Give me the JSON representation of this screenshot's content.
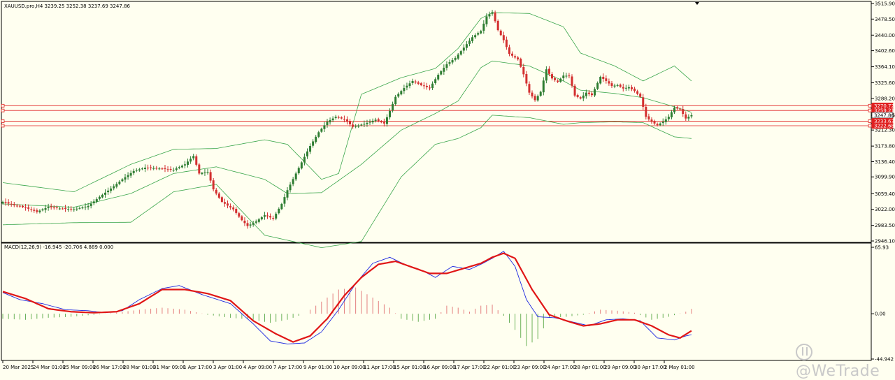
{
  "header": {
    "symbol_line": "XAUUSD.pro,H4  3239.25 3252.38 3237.69 3247.86"
  },
  "indicator": {
    "label": "MACD(12,26,9) -16.945 -20.706 4.889 0.000"
  },
  "watermark": {
    "text": "@WeTrade"
  },
  "colors": {
    "background": "#fffff0",
    "bull_candle": "#2e7d32",
    "bear_candle": "#d32f2f",
    "bollinger": "#3aa64a",
    "macd_line": "#1f2ae0",
    "signal_line": "#e01616",
    "hist_positive": "#e07070",
    "hist_negative": "#5aa846",
    "level_line": "#e02020",
    "grid_border": "#000000"
  },
  "chart_data": [
    {
      "type": "candlestick",
      "title": "XAUUSD.pro,H4",
      "y_ticks": [
        "3515.90",
        "3478.50",
        "3440.00",
        "3402.60",
        "3364.10",
        "3325.60",
        "3288.20",
        "3247.86",
        "3212.30",
        "3173.80",
        "3136.40",
        "3099.90",
        "3059.40",
        "3022.00",
        "2983.50",
        "2946.10"
      ],
      "ylim": [
        2946.1,
        3515.9
      ],
      "price_labels": [
        {
          "text": "3270.72",
          "value": 3270.72
        },
        {
          "text": "3259.21",
          "value": 3259.21
        },
        {
          "text": "3247.86",
          "value": 3247.86
        },
        {
          "text": "3233.63",
          "value": 3233.63
        },
        {
          "text": "3222.68",
          "value": 3222.68
        }
      ],
      "level_lines": [
        3270.72,
        3259.21,
        3233.63,
        3222.68
      ],
      "x_labels": [
        "20 Mar 2025",
        "24 Mar 01:00",
        "25 Mar 09:00",
        "26 Mar 17:00",
        "28 Mar 01:00",
        "31 Mar 09:00",
        "1 Apr 17:00",
        "3 Apr 01:00",
        "4 Apr 09:00",
        "7 Apr 17:00",
        "9 Apr 01:00",
        "10 Apr 09:00",
        "11 Apr 17:00",
        "15 Apr 01:00",
        "16 Apr 09:00",
        "17 Apr 17:00",
        "22 Apr 01:00",
        "23 Apr 09:00",
        "24 Apr 17:00",
        "28 Apr 01:00",
        "29 Apr 09:00",
        "30 Apr 17:00",
        "2 May 01:00"
      ],
      "close_anchors": [
        [
          0,
          3040
        ],
        [
          4,
          3032
        ],
        [
          8,
          3026
        ],
        [
          12,
          3016
        ],
        [
          16,
          3028
        ],
        [
          20,
          3024
        ],
        [
          25,
          3022
        ],
        [
          30,
          3030
        ],
        [
          34,
          3052
        ],
        [
          38,
          3072
        ],
        [
          42,
          3094
        ],
        [
          46,
          3114
        ],
        [
          50,
          3122
        ],
        [
          55,
          3120
        ],
        [
          60,
          3117
        ],
        [
          64,
          3130
        ],
        [
          67,
          3150
        ],
        [
          69,
          3108
        ],
        [
          72,
          3112
        ],
        [
          74,
          3070
        ],
        [
          77,
          3040
        ],
        [
          81,
          3022
        ],
        [
          84,
          2996
        ],
        [
          86,
          2982
        ],
        [
          89,
          2993
        ],
        [
          92,
          3008
        ],
        [
          95,
          3000
        ],
        [
          98,
          3035
        ],
        [
          100,
          3068
        ],
        [
          103,
          3108
        ],
        [
          106,
          3148
        ],
        [
          108,
          3174
        ],
        [
          111,
          3207
        ],
        [
          114,
          3232
        ],
        [
          117,
          3244
        ],
        [
          120,
          3238
        ],
        [
          123,
          3220
        ],
        [
          127,
          3227
        ],
        [
          131,
          3237
        ],
        [
          134,
          3228
        ],
        [
          136,
          3258
        ],
        [
          138,
          3292
        ],
        [
          141,
          3313
        ],
        [
          144,
          3330
        ],
        [
          147,
          3320
        ],
        [
          150,
          3313
        ],
        [
          153,
          3345
        ],
        [
          156,
          3370
        ],
        [
          159,
          3385
        ],
        [
          162,
          3410
        ],
        [
          165,
          3435
        ],
        [
          168,
          3450
        ],
        [
          170,
          3485
        ],
        [
          172,
          3495
        ],
        [
          174,
          3452
        ],
        [
          176,
          3428
        ],
        [
          178,
          3395
        ],
        [
          181,
          3382
        ],
        [
          183,
          3346
        ],
        [
          185,
          3302
        ],
        [
          187,
          3284
        ],
        [
          189,
          3304
        ],
        [
          191,
          3358
        ],
        [
          193,
          3336
        ],
        [
          195,
          3328
        ],
        [
          197,
          3343
        ],
        [
          199,
          3342
        ],
        [
          201,
          3295
        ],
        [
          203,
          3288
        ],
        [
          205,
          3302
        ],
        [
          207,
          3296
        ],
        [
          210,
          3340
        ],
        [
          212,
          3330
        ],
        [
          214,
          3318
        ],
        [
          216,
          3320
        ],
        [
          218,
          3312
        ],
        [
          220,
          3315
        ],
        [
          222,
          3306
        ],
        [
          224,
          3292
        ],
        [
          226,
          3244
        ],
        [
          228,
          3232
        ],
        [
          230,
          3224
        ],
        [
          232,
          3232
        ],
        [
          234,
          3244
        ],
        [
          236,
          3266
        ],
        [
          238,
          3262
        ],
        [
          240,
          3240
        ],
        [
          242,
          3247.86
        ]
      ],
      "bollinger_upper_anchors": [
        [
          0,
          3086
        ],
        [
          25,
          3064
        ],
        [
          45,
          3130
        ],
        [
          60,
          3166
        ],
        [
          75,
          3168
        ],
        [
          92,
          3189
        ],
        [
          100,
          3178
        ],
        [
          112,
          3094
        ],
        [
          118,
          3108
        ],
        [
          126,
          3298
        ],
        [
          140,
          3338
        ],
        [
          152,
          3360
        ],
        [
          160,
          3408
        ],
        [
          168,
          3480
        ],
        [
          172,
          3494
        ],
        [
          185,
          3492
        ],
        [
          197,
          3460
        ],
        [
          203,
          3397
        ],
        [
          215,
          3366
        ],
        [
          225,
          3330
        ],
        [
          236,
          3366
        ],
        [
          242,
          3330
        ]
      ],
      "bollinger_mid_anchors": [
        [
          0,
          3035
        ],
        [
          25,
          3027
        ],
        [
          45,
          3060
        ],
        [
          60,
          3108
        ],
        [
          75,
          3124
        ],
        [
          92,
          3094
        ],
        [
          100,
          3060
        ],
        [
          112,
          3062
        ],
        [
          126,
          3130
        ],
        [
          140,
          3212
        ],
        [
          152,
          3252
        ],
        [
          160,
          3282
        ],
        [
          168,
          3362
        ],
        [
          172,
          3378
        ],
        [
          185,
          3366
        ],
        [
          197,
          3330
        ],
        [
          203,
          3308
        ],
        [
          215,
          3300
        ],
        [
          225,
          3290
        ],
        [
          236,
          3268
        ],
        [
          242,
          3255
        ]
      ],
      "bollinger_lower_anchors": [
        [
          0,
          2985
        ],
        [
          25,
          2990
        ],
        [
          45,
          2991
        ],
        [
          60,
          3064
        ],
        [
          75,
          3082
        ],
        [
          92,
          2960
        ],
        [
          100,
          2948
        ],
        [
          112,
          2930
        ],
        [
          126,
          2945
        ],
        [
          140,
          3100
        ],
        [
          152,
          3178
        ],
        [
          160,
          3192
        ],
        [
          168,
          3218
        ],
        [
          172,
          3248
        ],
        [
          185,
          3242
        ],
        [
          197,
          3226
        ],
        [
          203,
          3230
        ],
        [
          215,
          3232
        ],
        [
          225,
          3230
        ],
        [
          236,
          3196
        ],
        [
          242,
          3192
        ]
      ],
      "last_price": 3247.86
    },
    {
      "type": "line",
      "title": "MACD(12,26,9)",
      "y_ticks": [
        "65.93",
        "0.00",
        "-44.942"
      ],
      "ylim": [
        -44.942,
        65.93
      ],
      "zero_line": 0,
      "series": [
        {
          "name": "MACD",
          "anchors": [
            [
              0,
              21
            ],
            [
              6,
              14
            ],
            [
              14,
              10
            ],
            [
              22,
              4
            ],
            [
              30,
              3
            ],
            [
              36,
              1
            ],
            [
              42,
              3
            ],
            [
              48,
              14
            ],
            [
              56,
              25
            ],
            [
              62,
              28
            ],
            [
              70,
              19
            ],
            [
              80,
              10
            ],
            [
              88,
              -10
            ],
            [
              94,
              -27
            ],
            [
              100,
              -30
            ],
            [
              106,
              -29
            ],
            [
              112,
              -18
            ],
            [
              118,
              4
            ],
            [
              124,
              30
            ],
            [
              130,
              50
            ],
            [
              136,
              56
            ],
            [
              142,
              48
            ],
            [
              148,
              42
            ],
            [
              152,
              36
            ],
            [
              158,
              47
            ],
            [
              164,
              44
            ],
            [
              168,
              49
            ],
            [
              172,
              55
            ],
            [
              176,
              62
            ],
            [
              180,
              47
            ],
            [
              184,
              14
            ],
            [
              188,
              -3
            ],
            [
              194,
              -4
            ],
            [
              200,
              -8
            ],
            [
              206,
              -12
            ],
            [
              212,
              -6
            ],
            [
              218,
              -5
            ],
            [
              224,
              -7
            ],
            [
              230,
              -24
            ],
            [
              236,
              -26
            ],
            [
              240,
              -22
            ],
            [
              242,
              -20.706
            ]
          ]
        },
        {
          "name": "Signal",
          "anchors": [
            [
              0,
              22
            ],
            [
              8,
              15
            ],
            [
              16,
              5
            ],
            [
              24,
              2
            ],
            [
              32,
              1
            ],
            [
              40,
              2
            ],
            [
              48,
              10
            ],
            [
              56,
              24
            ],
            [
              64,
              24
            ],
            [
              72,
              20
            ],
            [
              80,
              13
            ],
            [
              88,
              -7
            ],
            [
              96,
              -20
            ],
            [
              102,
              -28
            ],
            [
              108,
              -22
            ],
            [
              114,
              -5
            ],
            [
              120,
              18
            ],
            [
              126,
              36
            ],
            [
              132,
              49
            ],
            [
              138,
              52
            ],
            [
              144,
              46
            ],
            [
              150,
              40
            ],
            [
              156,
              40
            ],
            [
              162,
              45
            ],
            [
              168,
              50
            ],
            [
              172,
              56
            ],
            [
              176,
              60
            ],
            [
              180,
              55
            ],
            [
              186,
              24
            ],
            [
              192,
              -1
            ],
            [
              198,
              -7
            ],
            [
              204,
              -12
            ],
            [
              210,
              -10
            ],
            [
              216,
              -6
            ],
            [
              222,
              -6
            ],
            [
              228,
              -12
            ],
            [
              234,
              -21
            ],
            [
              238,
              -24
            ],
            [
              242,
              -16.945
            ]
          ]
        }
      ],
      "histogram_anchors": [
        [
          0,
          -5
        ],
        [
          8,
          -6
        ],
        [
          16,
          -4
        ],
        [
          24,
          -3
        ],
        [
          32,
          -1
        ],
        [
          40,
          1
        ],
        [
          48,
          4
        ],
        [
          56,
          6
        ],
        [
          64,
          4
        ],
        [
          72,
          -1
        ],
        [
          80,
          -4
        ],
        [
          88,
          -6
        ],
        [
          94,
          -9
        ],
        [
          100,
          -6
        ],
        [
          106,
          0
        ],
        [
          112,
          12
        ],
        [
          118,
          24
        ],
        [
          124,
          26
        ],
        [
          130,
          16
        ],
        [
          136,
          6
        ],
        [
          140,
          -5
        ],
        [
          146,
          -8
        ],
        [
          152,
          -5
        ],
        [
          156,
          8
        ],
        [
          160,
          6
        ],
        [
          164,
          2
        ],
        [
          168,
          8
        ],
        [
          172,
          9
        ],
        [
          176,
          -2
        ],
        [
          180,
          -16
        ],
        [
          184,
          -32
        ],
        [
          188,
          -25
        ],
        [
          192,
          -4
        ],
        [
          198,
          -3
        ],
        [
          204,
          -1
        ],
        [
          210,
          4
        ],
        [
          216,
          3
        ],
        [
          222,
          1
        ],
        [
          228,
          -6
        ],
        [
          234,
          -3
        ],
        [
          240,
          2
        ],
        [
          242,
          4.889
        ]
      ]
    }
  ]
}
